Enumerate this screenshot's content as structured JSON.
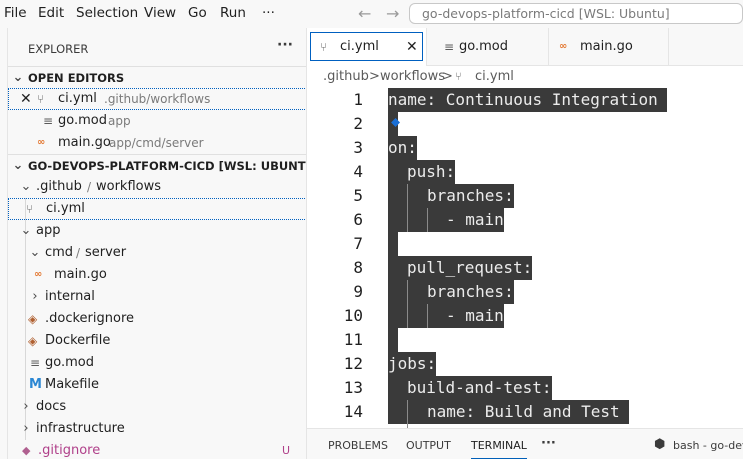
{
  "menubar": {
    "items": [
      "File",
      "Edit",
      "Selection",
      "View",
      "Go",
      "Run",
      "···"
    ],
    "back_icon": "arrow-left-icon",
    "forward_icon": "arrow-right-icon",
    "command_center": "go-devops-platform-cicd [WSL: Ubuntu]"
  },
  "sidebar": {
    "title": "EXPLORER",
    "more": "···",
    "open_editors": {
      "title": "OPEN EDITORS",
      "items": [
        {
          "name": "ci.yml",
          "path": ".github/workflows",
          "icon": "yaml-file-icon",
          "close": "✕"
        },
        {
          "name": "go.mod",
          "path": "app",
          "icon": "go-mod-file-icon"
        },
        {
          "name": "main.go",
          "path": "app/cmd/server",
          "icon": "go-file-icon"
        }
      ]
    },
    "workspace": {
      "title": "GO-DEVOPS-PLATFORM-CICD [WSL: UBUNTU]",
      "tree": [
        {
          "label": ".github",
          "label2": "workflows",
          "sep": "/",
          "kind": "folder-open"
        },
        {
          "label": "ci.yml",
          "kind": "file",
          "icon": "yaml-file-icon"
        },
        {
          "label": "app",
          "kind": "folder-open"
        },
        {
          "label": "cmd",
          "label2": "server",
          "sep": "/",
          "kind": "folder-open"
        },
        {
          "label": "main.go",
          "kind": "file",
          "icon": "go-file-icon"
        },
        {
          "label": "internal",
          "kind": "folder-closed"
        },
        {
          "label": ".dockerignore",
          "kind": "file",
          "icon": "docker-file-icon"
        },
        {
          "label": "Dockerfile",
          "kind": "file",
          "icon": "docker-file-icon"
        },
        {
          "label": "go.mod",
          "kind": "file",
          "icon": "go-mod-file-icon"
        },
        {
          "label": "Makefile",
          "kind": "file",
          "icon": "makefile-icon"
        },
        {
          "label": "docs",
          "kind": "folder-closed"
        },
        {
          "label": "infrastructure",
          "kind": "folder-closed"
        },
        {
          "label": ".gitignore",
          "kind": "file",
          "icon": "git-file-icon",
          "badge": "U"
        }
      ]
    }
  },
  "tabs": [
    {
      "label": "ci.yml",
      "icon": "yaml-file-icon",
      "active": true,
      "close": "✕"
    },
    {
      "label": "go.mod",
      "icon": "go-mod-file-icon"
    },
    {
      "label": "main.go",
      "icon": "go-file-icon"
    }
  ],
  "breadcrumb": {
    "parts": [
      ".github",
      "workflows",
      "ci.yml"
    ],
    "sep": ">"
  },
  "editor": {
    "lines": [
      {
        "n": "1",
        "indent": 0,
        "text": "name: Continuous Integration "
      },
      {
        "n": "2",
        "indent": 0,
        "text": ""
      },
      {
        "n": "3",
        "indent": 0,
        "text": "on:"
      },
      {
        "n": "4",
        "indent": 1,
        "text": "push:"
      },
      {
        "n": "5",
        "indent": 2,
        "text": "branches:"
      },
      {
        "n": "6",
        "indent": 3,
        "text": "- main"
      },
      {
        "n": "7",
        "indent": 0,
        "text": ""
      },
      {
        "n": "8",
        "indent": 1,
        "text": "pull_request:"
      },
      {
        "n": "9",
        "indent": 2,
        "text": "branches:"
      },
      {
        "n": "10",
        "indent": 3,
        "text": "- main"
      },
      {
        "n": "11",
        "indent": 0,
        "text": ""
      },
      {
        "n": "12",
        "indent": 0,
        "text": "jobs:"
      },
      {
        "n": "13",
        "indent": 1,
        "text": "build-and-test:"
      },
      {
        "n": "14",
        "indent": 2,
        "text": "name: Build and Test "
      }
    ]
  },
  "panel": {
    "tabs": [
      "PROBLEMS",
      "OUTPUT",
      "TERMINAL"
    ],
    "active": "TERMINAL",
    "more": "···",
    "terminal_label": "bash - go-devo"
  },
  "colors": {
    "accent": "#005fb8",
    "selection": "#3a3a3a",
    "go_icon": "#e37933",
    "makefile_icon": "#2b87d3"
  }
}
